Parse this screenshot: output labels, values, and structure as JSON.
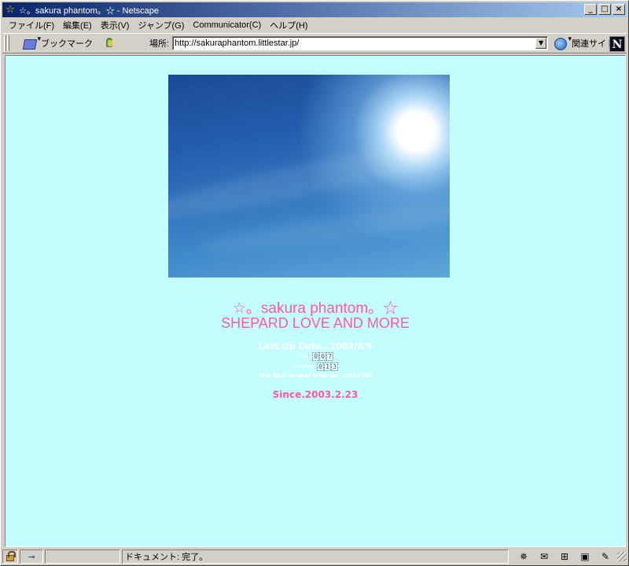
{
  "window": {
    "title": "☆。sakura phantom。☆ - Netscape",
    "title_icon": "☆",
    "buttons": {
      "minimize": "_",
      "maximize": "□",
      "close": "×"
    }
  },
  "menu": {
    "items": [
      "ファイル(F)",
      "編集(E)",
      "表示(V)",
      "ジャンプ(G)",
      "Communicator(C)",
      "ヘルプ(H)"
    ]
  },
  "toolbar": {
    "bookmarks_label": "ブックマーク",
    "location_label": "場所:",
    "url": "http://sakuraphantom.littlestar.jp/",
    "related_label": "関連サイト",
    "logo": "N"
  },
  "page": {
    "title": "☆。sakura phantom。☆",
    "subtitle": "SHEPARD LOVE AND MORE",
    "last_update": "Last Up Date…2003/8/5",
    "today_label": "Today",
    "today_digits": [
      "0",
      "0",
      "7"
    ],
    "yesterday_label": "Yesterday",
    "yesterday_digits": [
      "0",
      "1",
      "3"
    ],
    "best_viewed": "Site Best Viewed With Ie6 1024×768",
    "since": "Since.2003.2.23"
  },
  "status": {
    "text": "ドキュメント: 完了。"
  },
  "colors": {
    "background": "#c4ffff",
    "pink": "#ff5aa0",
    "titlebar_start": "#0a246a",
    "titlebar_end": "#a6caf0"
  }
}
